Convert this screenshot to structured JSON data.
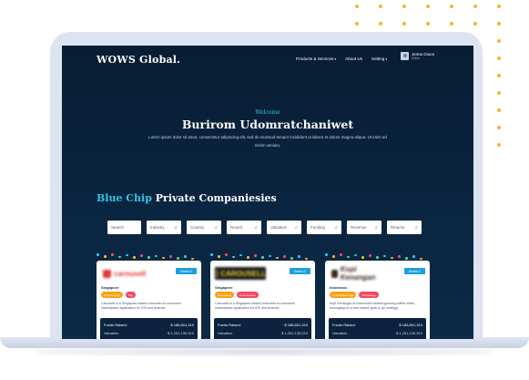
{
  "brand": {
    "logo": "WOWS Global."
  },
  "nav": {
    "items": [
      {
        "label": "Products & Services",
        "dropdown": true
      },
      {
        "label": "About Us",
        "dropdown": false
      },
      {
        "label": "Setting",
        "dropdown": true
      }
    ],
    "caret_glyph": "▾"
  },
  "user": {
    "name": "Jenna Grace",
    "role": "Editor"
  },
  "hero": {
    "welcome": "Welcome",
    "title": "Burirom Udomratchaniwet",
    "subtitle": "Lorem ipsum dolor sit amet, consectetur adipiscing elit, sed do eiusmod tempor incididunt ut labore et dolore magna aliqua. Ut enim ad minim veniam,"
  },
  "section": {
    "title_highlight": "Blue Chip",
    "title_rest": " Private Companiesies"
  },
  "filters": {
    "search_placeholder": "Search",
    "items": [
      "Industry",
      "Country",
      "Round",
      "Valuation",
      "Funding",
      "Revenue",
      "Returns"
    ],
    "chevron_glyph": "⇵"
  },
  "cards": [
    {
      "logo_text": "carousell",
      "button": "Series D",
      "location": "Singapore",
      "tags": [
        "E-Commerce",
        "Tag"
      ],
      "description": "Carousell is a Singapore-based consumer-to-consumer marketplace application for iOS and Android.",
      "funds_label": "Funds Raised:",
      "funds_value": "$ 186,801,310",
      "valuation_label": "Valuation",
      "valuation_value": "$ 1,251,130,510"
    },
    {
      "logo_text": "CAROUSELL",
      "button": "Series D",
      "location": "Singapore",
      "tags": [
        "Automotive",
        "E-Commerce"
      ],
      "description": "Carousell is a Singapore-based consumer-to-consumer marketplace application for iOS and Android.",
      "funds_label": "Funds Raised:",
      "funds_value": "$ 186,801,310",
      "valuation_label": "Valuation",
      "valuation_value": "$ 1,251,130,510"
    },
    {
      "logo_text": "Kopi Kenangan",
      "button": "Series C",
      "location": "Indonesia",
      "tags": [
        "Food & Beverage",
        "Technology"
      ],
      "description": "Kopi Kenangan is Indonesia's fastest-growing coffee chain, leveraging on a tech-based 'grab & go' strategy.",
      "funds_label": "Funds Raised:",
      "funds_value": "$ 186,801,310",
      "valuation_label": "Valuation",
      "valuation_value": "$ 1,251,130,510"
    }
  ],
  "colors": {
    "accent": "#2ec6e8",
    "button_blue": "#1c9ee0",
    "dot_orange": "#f5b335",
    "tag_orange": "#f6a21a",
    "tag_red": "#ef4a63",
    "navy": "#0a2540"
  }
}
